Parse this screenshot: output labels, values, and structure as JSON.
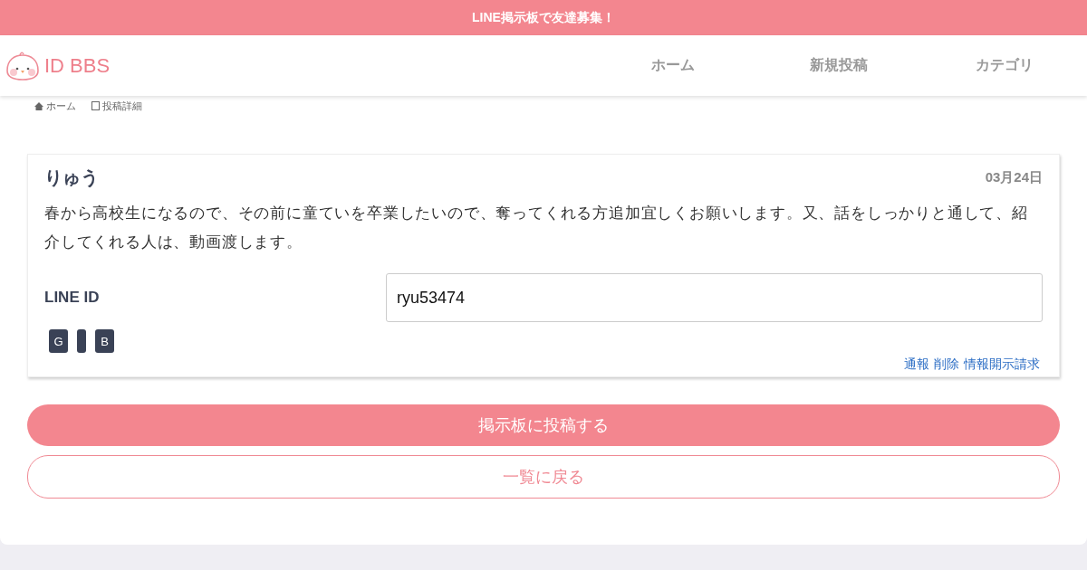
{
  "banner": {
    "text": "LINE掲示板で友達募集！"
  },
  "header": {
    "logo": "ID BBS",
    "nav": [
      {
        "label": "ホーム"
      },
      {
        "label": "新規投稿"
      },
      {
        "label": "カテゴリ"
      }
    ]
  },
  "breadcrumb": [
    {
      "kind": "home",
      "label": "ホーム"
    },
    {
      "kind": "page",
      "label": "投稿詳細"
    }
  ],
  "post": {
    "author": "りゅう",
    "date": "03月24日",
    "body": "春から高校生になるので、その前に童ていを卒業したいので、奪ってくれる方追加宜しくお願いします。又、話をしっかりと通して、紹介してくれる人は、動画渡します。",
    "id_label": "LINE ID",
    "id_value": "ryu53474",
    "badges": [
      {
        "kind": "letter",
        "label": "G"
      },
      {
        "kind": "blank"
      },
      {
        "kind": "letter",
        "label": "B"
      }
    ],
    "links": [
      "通報",
      "削除",
      "情報開示請求"
    ]
  },
  "buttons": {
    "primary": "掲示板に投稿する",
    "secondary": "一覧に戻る"
  }
}
